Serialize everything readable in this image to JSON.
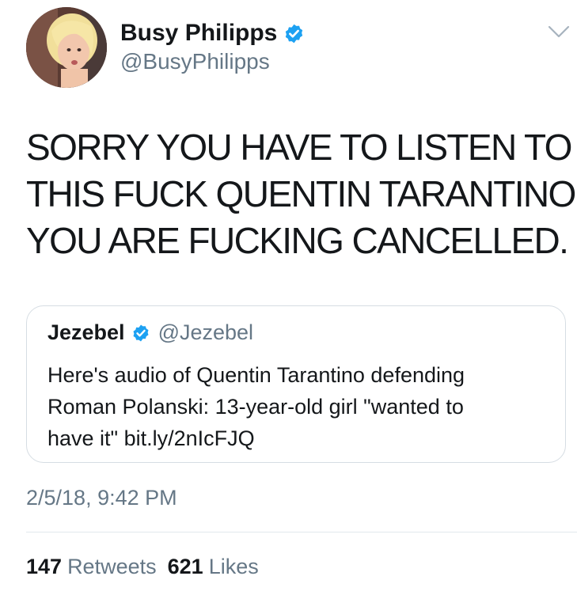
{
  "author": {
    "display_name": "Busy Philipps",
    "handle": "@BusyPhilipps",
    "verified": true
  },
  "tweet": {
    "text_lines": [
      "SORRY YOU HAVE TO LISTEN TO",
      "THIS FUCK QUENTIN TARANTINO",
      "YOU ARE FUCKING CANCELLED."
    ],
    "timestamp": "2/5/18, 9:42 PM"
  },
  "quoted_tweet": {
    "display_name": "Jezebel",
    "handle": "@Jezebel",
    "verified": true,
    "text_lines": [
      "Here's audio of Quentin Tarantino defending",
      "Roman Polanski: 13-year-old girl \"wanted to",
      "have it\" bit.ly/2nIcFJQ"
    ]
  },
  "stats": {
    "retweets_count": "147",
    "retweets_label": "Retweets",
    "likes_count": "621",
    "likes_label": "Likes"
  },
  "colors": {
    "verified_blue": "#1da1f2",
    "secondary_text": "#657786",
    "border": "#d6dde3"
  }
}
